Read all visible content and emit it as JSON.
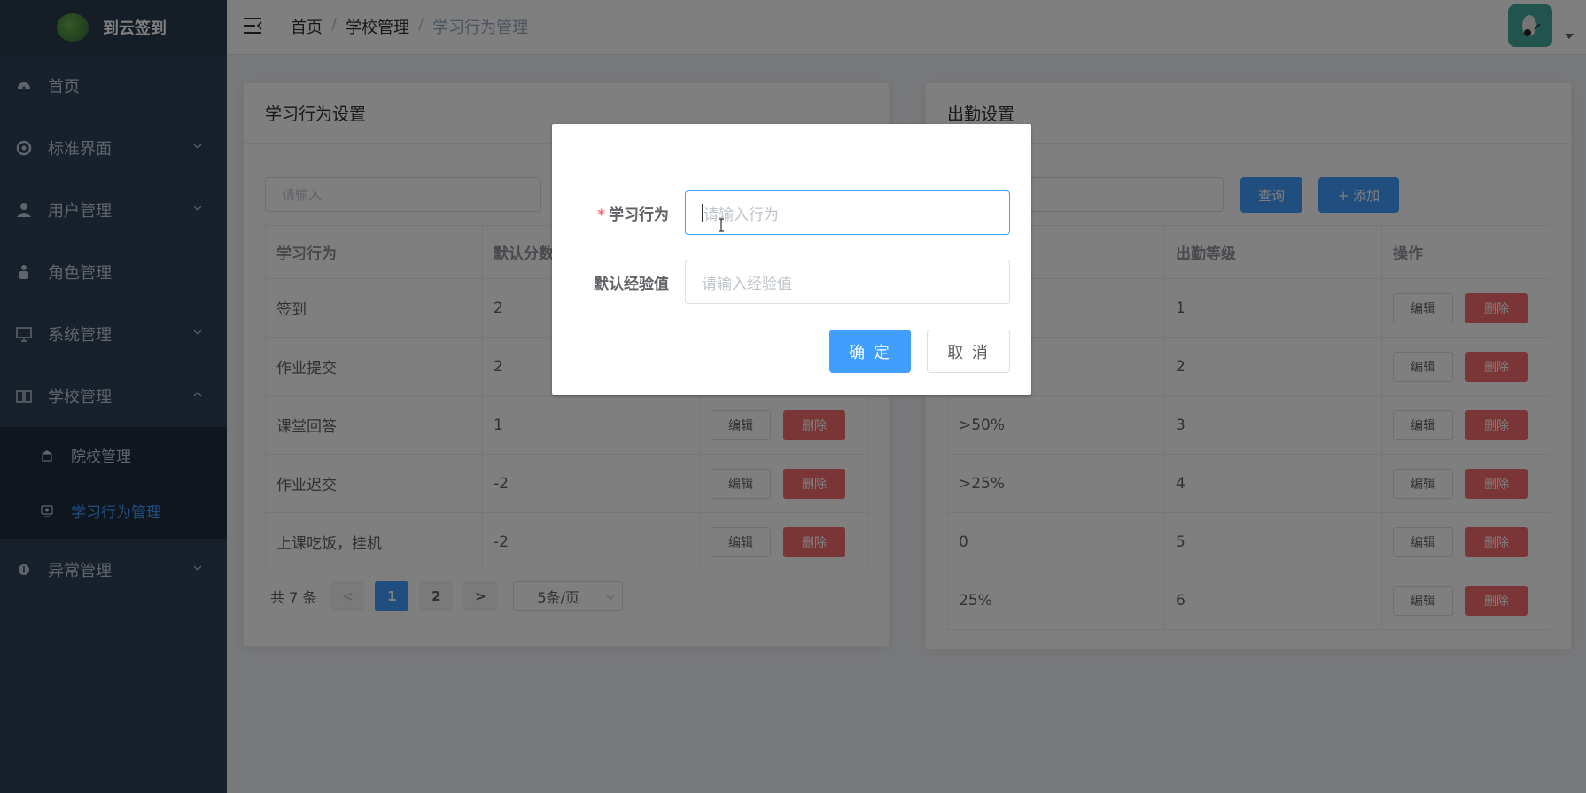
{
  "sidebar": {
    "logo_text": "到云签到",
    "items": [
      {
        "label": "首页",
        "icon": "dashboard-icon"
      },
      {
        "label": "标准界面",
        "icon": "aperture-icon"
      },
      {
        "label": "用户管理",
        "icon": "user-icon"
      },
      {
        "label": "角色管理",
        "icon": "role-icon"
      },
      {
        "label": "系统管理",
        "icon": "monitor-icon"
      },
      {
        "label": "学校管理",
        "icon": "book-icon"
      },
      {
        "label": "异常管理",
        "icon": "warning-icon"
      }
    ],
    "submenu": [
      {
        "label": "院校管理",
        "icon": "school-icon"
      },
      {
        "label": "学习行为管理",
        "icon": "behavior-icon"
      }
    ]
  },
  "header": {
    "breadcrumb": [
      "首页",
      "学校管理",
      "学习行为管理"
    ],
    "breadcrumb_sep": "/"
  },
  "left_card": {
    "title": "学习行为设置",
    "search_placeholder": "请输入",
    "columns": [
      "学习行为",
      "默认分数",
      ""
    ],
    "rows": [
      {
        "behavior": "签到",
        "score": "2"
      },
      {
        "behavior": "作业提交",
        "score": "2"
      },
      {
        "behavior": "课堂回答",
        "score": "1"
      },
      {
        "behavior": "作业迟交",
        "score": "-2"
      },
      {
        "behavior": "上课吃饭，挂机",
        "score": "-2"
      }
    ],
    "edit_label": "编辑",
    "delete_label": "删除",
    "pager": {
      "total": "共 7 条",
      "prev": "<",
      "pages": [
        "1",
        "2"
      ],
      "next": ">",
      "size": "5条/页"
    }
  },
  "right_card": {
    "title": "出勤设置",
    "query_label": "查询",
    "add_label": "+ 添加",
    "columns": [
      "",
      "出勤等级",
      "操作"
    ],
    "rows": [
      {
        "rate": "",
        "level": "1"
      },
      {
        "rate": "",
        "level": "2"
      },
      {
        "rate": ">50%",
        "level": "3"
      },
      {
        "rate": ">25%",
        "level": "4"
      },
      {
        "rate": "0",
        "level": "5"
      },
      {
        "rate": "25%",
        "level": "6"
      }
    ],
    "edit_label": "编辑",
    "delete_label": "删除"
  },
  "dialog": {
    "behavior_label": "学习行为",
    "required_mark": "*",
    "behavior_placeholder": "请输入行为",
    "exp_label": "默认经验值",
    "exp_placeholder": "请输入经验值",
    "confirm_label": "确 定",
    "cancel_label": "取 消"
  },
  "colors": {
    "sidebar_bg": "#304156",
    "primary": "#409eff",
    "danger": "#f56c6c",
    "avatar": "#40a89a"
  }
}
